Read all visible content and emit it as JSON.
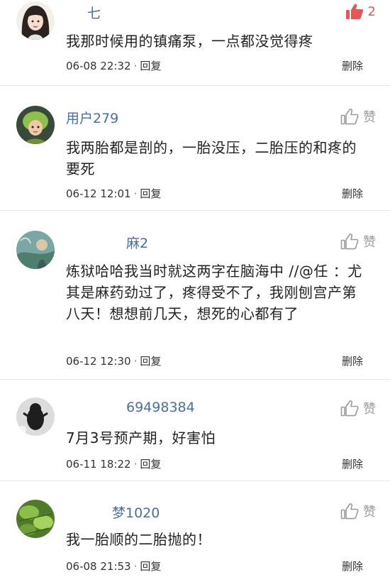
{
  "comments": [
    {
      "username": "七",
      "text": "我那时候用的镇痛泵，一点都没觉得疼",
      "time": "06-08 22:32",
      "reply_label": "回复",
      "delete_label": "删除",
      "like_label": "2",
      "liked": true
    },
    {
      "username": "用户279",
      "text": "我两胎都是剖的，一胎没压，二胎压的和疼的要死",
      "time": "06-12 12:01",
      "reply_label": "回复",
      "delete_label": "删除",
      "like_label": "赞",
      "liked": false
    },
    {
      "username": "麻2",
      "text": "炼狱哈哈我当时就这两字在脑海中 //@任 ：尤其是麻药劲过了，疼得受不了，我刚刨宫产第八天！想想前几天，想死的心都有了",
      "time": "06-12 12:30",
      "reply_label": "回复",
      "delete_label": "删除",
      "like_label": "赞",
      "liked": false
    },
    {
      "username": "69498384",
      "text": "7月3号预产期，好害怕",
      "time": "06-11 18:22",
      "reply_label": "回复",
      "delete_label": "删除",
      "like_label": "赞",
      "liked": false
    },
    {
      "username": "梦1020",
      "text": "我一胎顺的二胎抛的！",
      "time": "06-08 21:53",
      "reply_label": "回复",
      "delete_label": "删除",
      "like_label": "赞",
      "liked": false
    }
  ],
  "colors": {
    "username": "#4a6f9b",
    "like_active": "#e05a5a",
    "like_inactive": "#9a9a9a"
  },
  "icons": {
    "like": "thumbs-up-icon"
  }
}
